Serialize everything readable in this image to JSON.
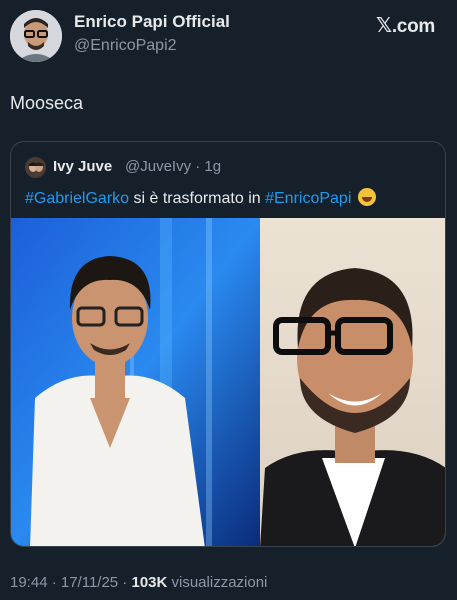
{
  "header": {
    "display_name": "Enrico Papi Official",
    "handle": "@EnricoPapi2",
    "brand": ".com"
  },
  "post": {
    "text": "Mooseca"
  },
  "quote": {
    "name": "Ivy Juve",
    "handle_time": "@JuveIvy · 1g",
    "hashtag1": "#GabrielGarko",
    "middle_text": " si è trasformato in ",
    "hashtag2": "#EnricoPapi"
  },
  "footer": {
    "time_date": "19:44 · 17/11/25 · ",
    "views_count": "103K",
    "views_label": " visualizzazioni"
  },
  "colors": {
    "background": "#15202b",
    "link": "#1d9bf0",
    "muted": "#8b98a5",
    "border": "#38444d"
  },
  "icons": [
    "x-logo-icon",
    "laughing-emoji-icon"
  ]
}
